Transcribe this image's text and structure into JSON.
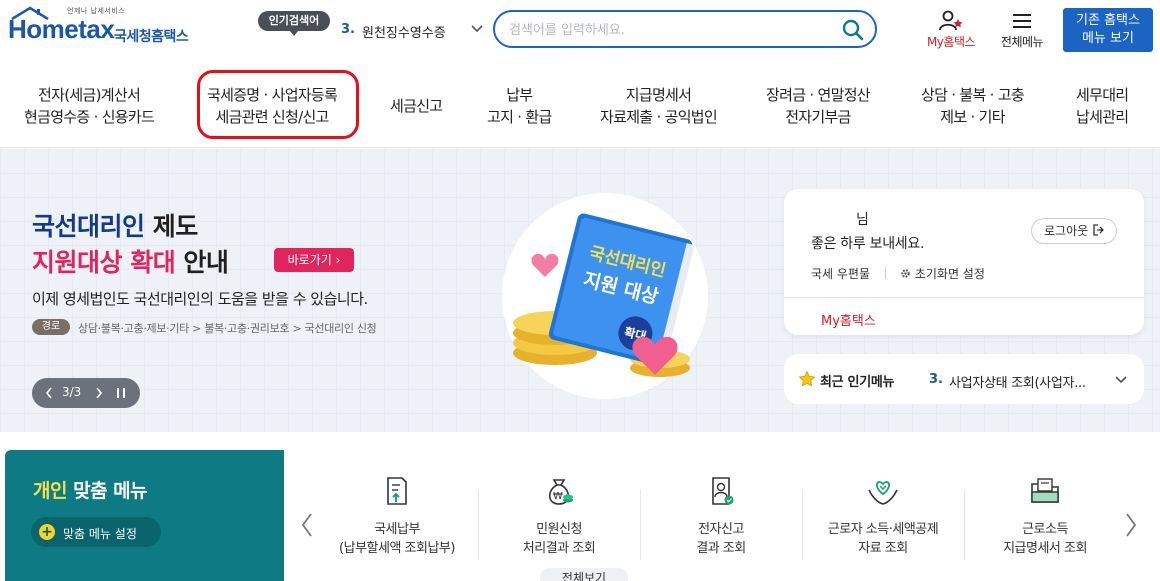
{
  "header": {
    "logo": {
      "tagline": "언제나 납세서비스",
      "brand": "Hometax",
      "korean_name": "국세청홈택스"
    },
    "popular_search": {
      "badge": "인기검색어",
      "rank": "3.",
      "keyword": "원천징수영수증"
    },
    "search": {
      "placeholder": "검색어를 입력하세요."
    },
    "my_hometax_label": "My홈택스",
    "all_menu_label": "전체메뉴",
    "old_menu_button": {
      "line1": "기존 홈택스",
      "line2": "메뉴 보기"
    }
  },
  "gnb": {
    "items": [
      {
        "line1": "전자(세금)계산서",
        "line2": "현금영수증 · 신용카드"
      },
      {
        "line1": "국세증명 · 사업자등록",
        "line2": "세금관련 신청/신고"
      },
      {
        "line1": "세금신고",
        "line2": ""
      },
      {
        "line1": "납부",
        "line2": "고지 · 환급"
      },
      {
        "line1": "지급명세서",
        "line2": "자료제출 · 공익법인"
      },
      {
        "line1": "장려금 · 연말정산",
        "line2": "전자기부금"
      },
      {
        "line1": "상담 · 불복 · 고충",
        "line2": "제보 · 기타"
      },
      {
        "line1": "세무대리",
        "line2": "납세관리"
      }
    ]
  },
  "hero": {
    "title1_a": "국선대리인",
    "title1_b": " 제도",
    "title2_a": "지원대상 확대",
    "title2_b": " 안내",
    "go_button": "바로가기 ›",
    "description": "이제 영세법인도 국선대리인의 도움을 받을 수 있습니다.",
    "path_badge": "경로",
    "path": "상담·불복·고충·제보·기타 > 불복·고충·권리보호 > 국선대리인 신청",
    "slider_count": "3/3",
    "illustration": {
      "book_line1": "국선대리인",
      "book_line2": "지원 대상",
      "tag": "확대"
    }
  },
  "login": {
    "user_suffix": "님",
    "greeting": "좋은 하루 보내세요.",
    "logout": "로그아웃",
    "postbox": "국세 우편물",
    "init_screen": "초기화면 설정",
    "my_hometax": "My홈택스"
  },
  "popular_menu": {
    "title": "최근 인기메뉴",
    "rank": "3.",
    "item": "사업자상태 조회(사업자..."
  },
  "personal": {
    "title_highlight": "개인",
    "title_rest": " 맞춤 메뉴",
    "setting_button": "맞춤 메뉴 설정"
  },
  "quick_menu": {
    "items": [
      {
        "line1": "국세납부",
        "line2": "(납부할세액 조회납부)",
        "icon": "tax-payment-icon"
      },
      {
        "line1": "민원신청",
        "line2": "처리결과 조회",
        "icon": "money-bag-icon"
      },
      {
        "line1": "전자신고",
        "line2": "결과 조회",
        "icon": "document-person-icon"
      },
      {
        "line1": "근로자 소득·세액공제",
        "line2": "자료 조회",
        "icon": "heart-hands-icon"
      },
      {
        "line1": "근로소득",
        "line2": "지급명세서 조회",
        "icon": "folder-doc-icon"
      }
    ],
    "view_all": "전체보기"
  },
  "colors": {
    "brand_blue": "#1b64c4",
    "alert_red": "#e2101a",
    "hero_pink": "#e0245e",
    "personal_teal": "#0e7a83"
  }
}
